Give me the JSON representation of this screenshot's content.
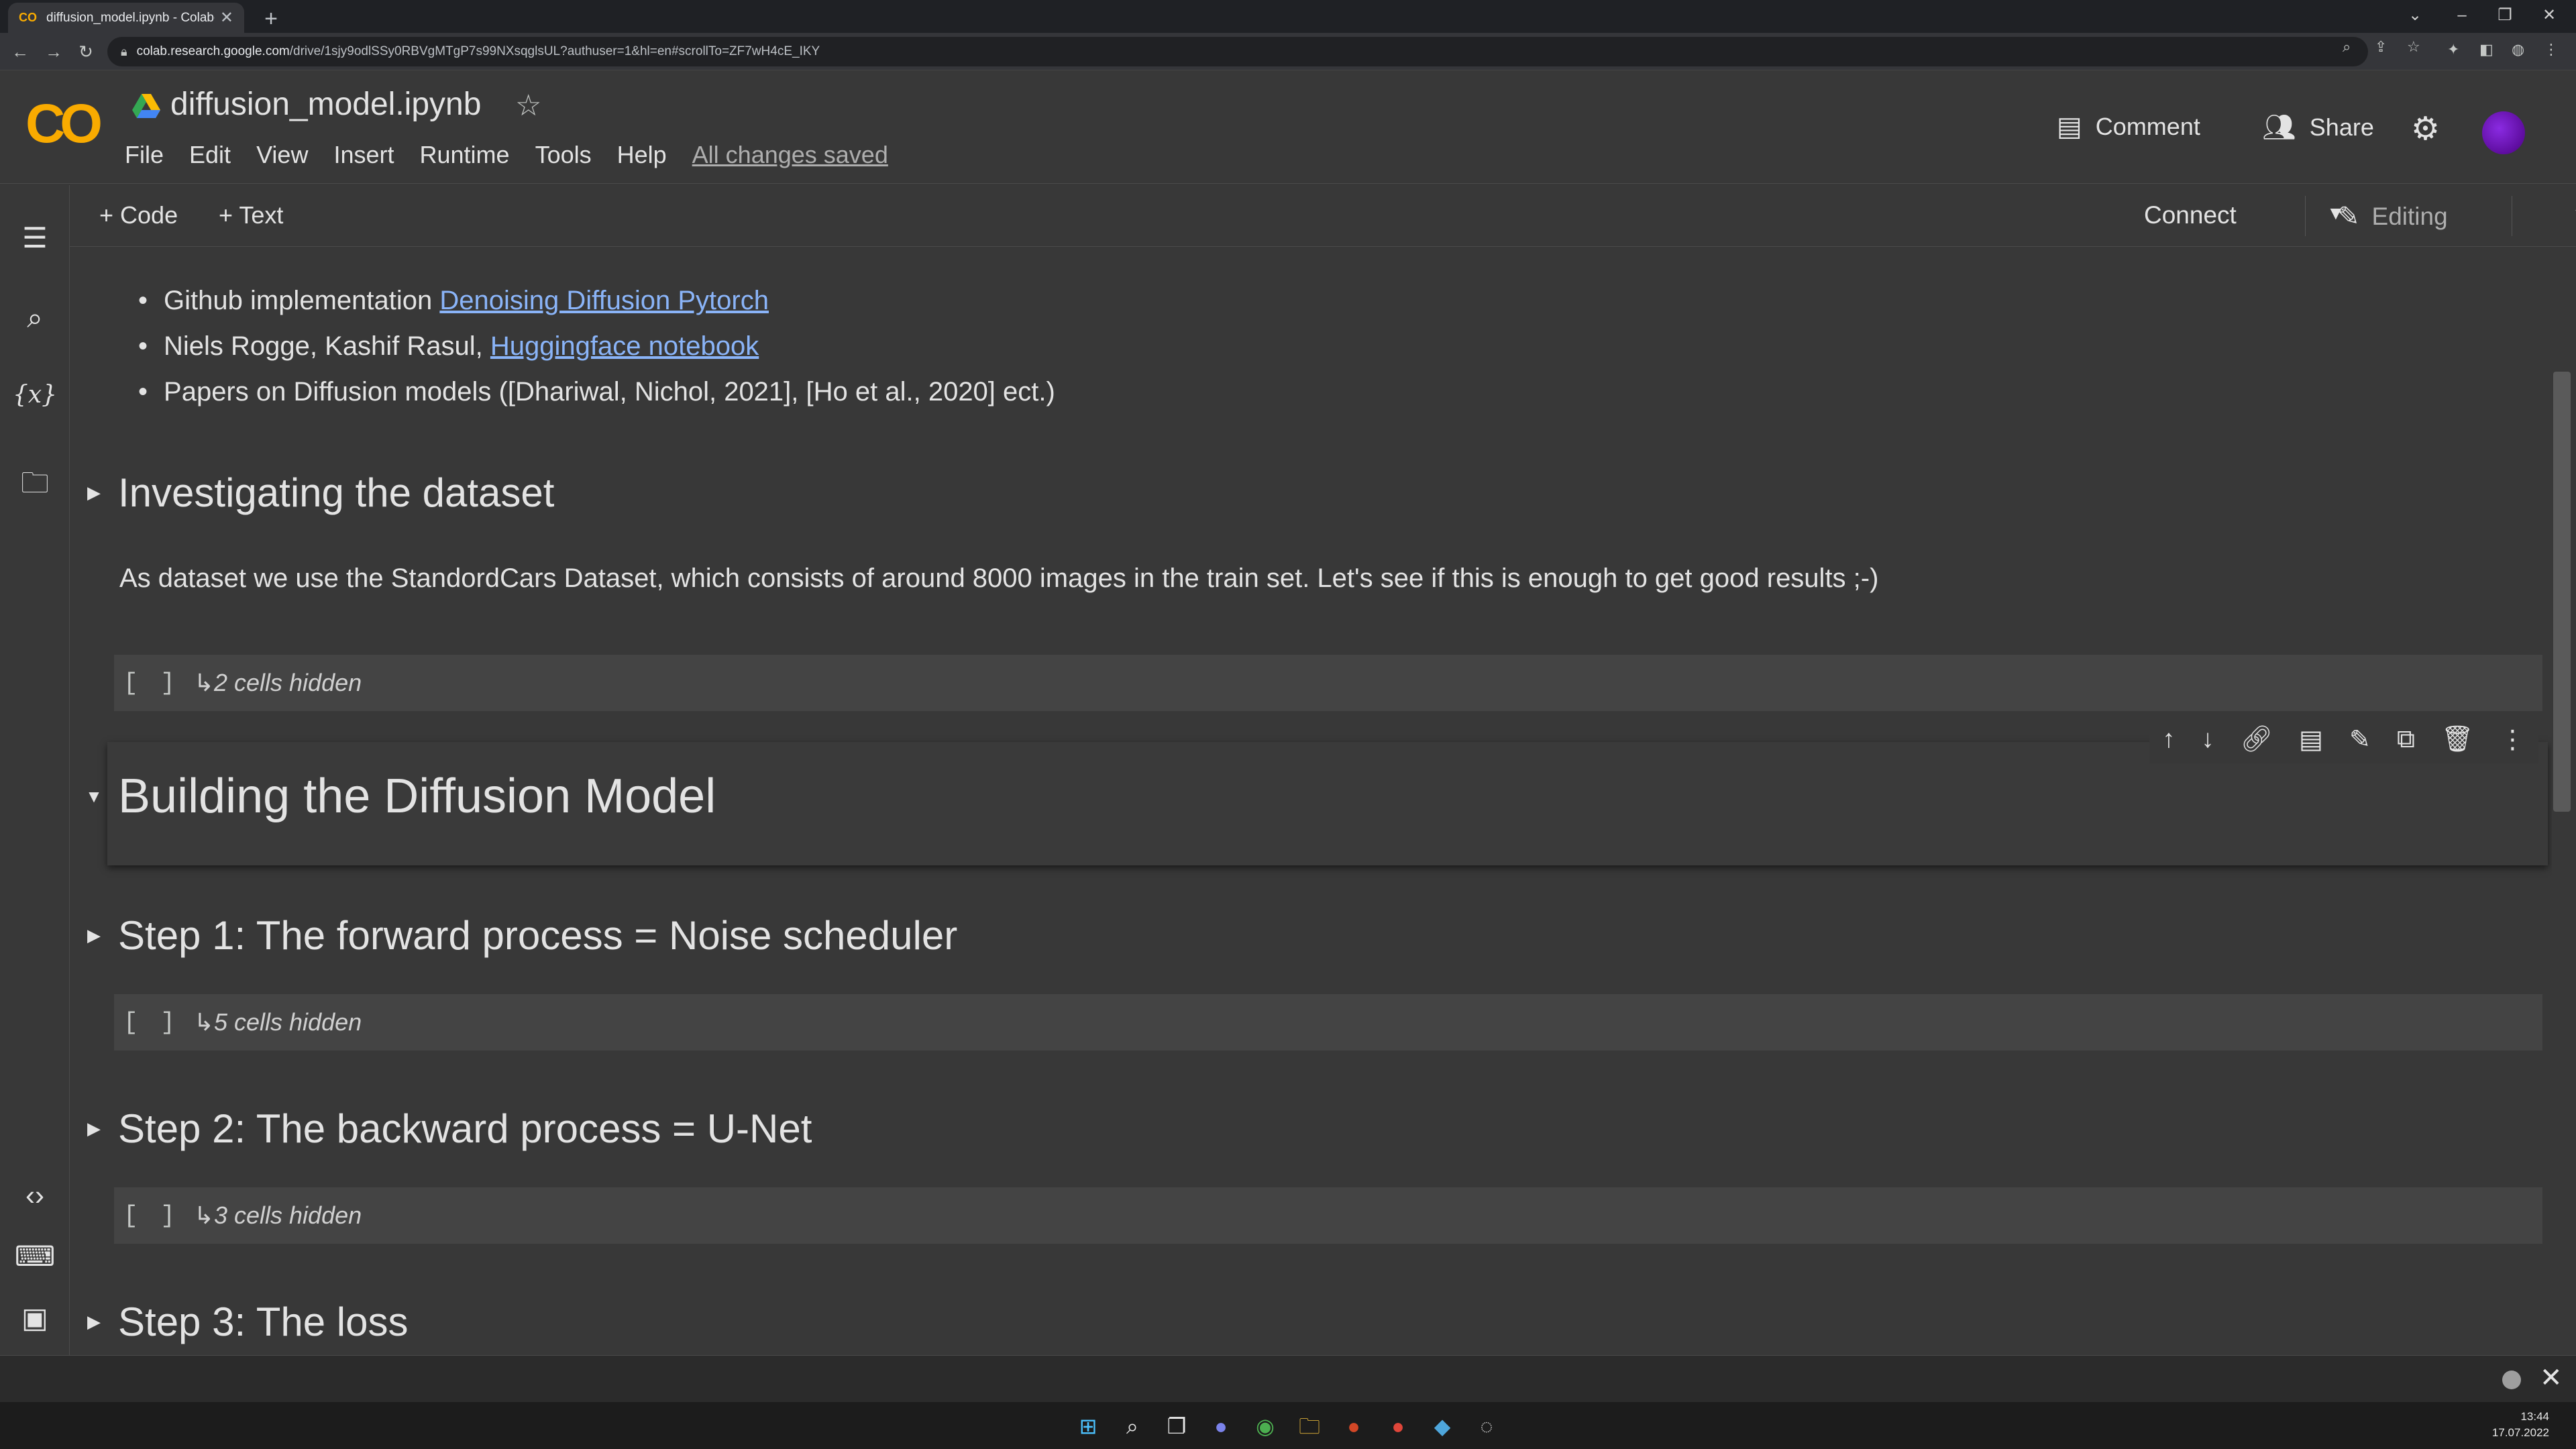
{
  "browser": {
    "tab_favicon": "CO",
    "tab_title": "diffusion_model.ipynb - Colabora",
    "tab_close": "✕",
    "new_tab": "+",
    "url_host": "colab.research.google.com",
    "url_path": "/drive/1sjy9odlSSy0RBVgMTgP7s99NXsqglsUL?authuser=1&hl=en#scrollTo=ZF7wH4cE_IKY"
  },
  "header": {
    "logo": "CO",
    "title": "diffusion_model.ipynb",
    "menus": [
      "File",
      "Edit",
      "View",
      "Insert",
      "Runtime",
      "Tools",
      "Help"
    ],
    "save_status": "All changes saved",
    "comment_label": "Comment",
    "share_label": "Share"
  },
  "toolbar": {
    "add_code": "+ Code",
    "add_text": "+ Text",
    "connect": "Connect",
    "editing": "Editing"
  },
  "content": {
    "bullets": [
      {
        "prefix": "Github implementation ",
        "link": "Denoising Diffusion Pytorch",
        "suffix": ""
      },
      {
        "prefix": "Niels Rogge, Kashif Rasul, ",
        "link": "Huggingface notebook",
        "suffix": ""
      },
      {
        "prefix": "Papers on Diffusion models ([Dhariwal, Nichol, 2021], [Ho et al., 2020] ect.)",
        "link": "",
        "suffix": ""
      }
    ],
    "section_dataset": "Investigating the dataset",
    "dataset_paragraph": "As dataset we use the StandordCars Dataset, which consists of around 8000 images in the train set. Let's see if this is enough to get good results ;-)",
    "hidden_dataset": "2 cells hidden",
    "section_building": "Building the Diffusion Model",
    "section_step1": "Step 1: The forward process = Noise scheduler",
    "hidden_step1": "5 cells hidden",
    "section_step2": "Step 2: The backward process = U-Net",
    "hidden_step2": "3 cells hidden",
    "section_step3": "Step 3: The loss",
    "hidden_bracket": "[ ]",
    "hidden_glyph": "↳"
  },
  "taskbar": {
    "time": "13:44",
    "date": "17.07.2022"
  },
  "colors": {
    "accent_orange": "#f9ab00",
    "link_blue": "#8ab4f8",
    "background": "#383838"
  }
}
